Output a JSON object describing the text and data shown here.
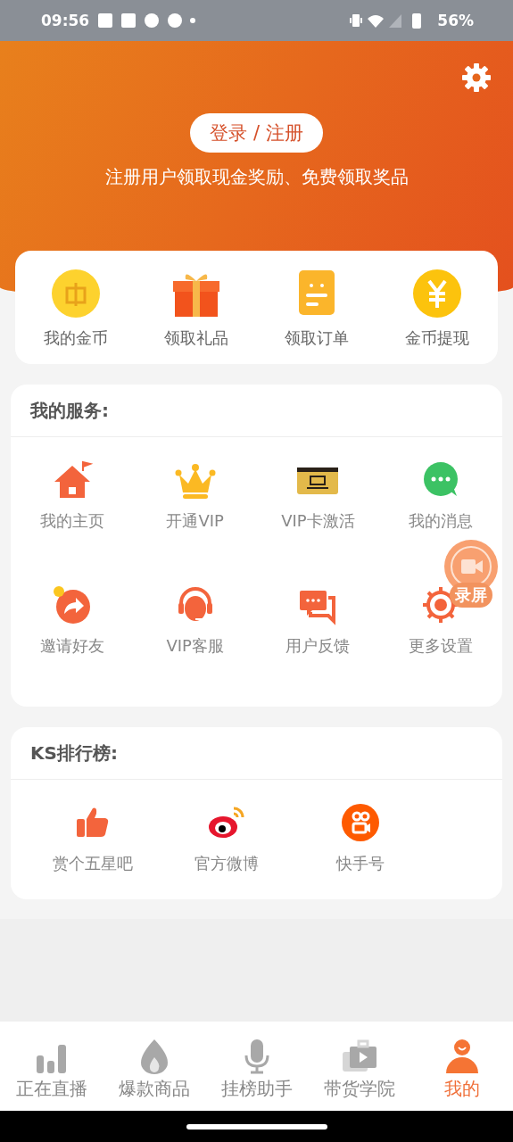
{
  "status_bar": {
    "time": "09:56",
    "battery": "56%"
  },
  "header": {
    "login_button": "登录 / 注册",
    "subtitle": "注册用户领取现金奖励、免费领取奖品"
  },
  "quick_actions": [
    {
      "kind": "coin",
      "label": "我的金币"
    },
    {
      "kind": "gift",
      "label": "领取礼品"
    },
    {
      "kind": "order",
      "label": "领取订单"
    },
    {
      "kind": "yuan",
      "label": "金币提现"
    }
  ],
  "services": {
    "title": "我的服务:",
    "items": [
      {
        "kind": "home",
        "label": "我的主页"
      },
      {
        "kind": "crown",
        "label": "开通VIP"
      },
      {
        "kind": "card",
        "label": "VIP卡激活"
      },
      {
        "kind": "message",
        "label": "我的消息"
      },
      {
        "kind": "share",
        "label": "邀请好友"
      },
      {
        "kind": "headset",
        "label": "VIP客服"
      },
      {
        "kind": "feedback",
        "label": "用户反馈"
      },
      {
        "kind": "gear",
        "label": "更多设置"
      }
    ]
  },
  "ranking": {
    "title": "KS排行榜:",
    "items": [
      {
        "kind": "thumb",
        "label": "赏个五星吧"
      },
      {
        "kind": "weibo",
        "label": "官方微博"
      },
      {
        "kind": "camera",
        "label": "快手号"
      }
    ]
  },
  "floating_record": {
    "label": "录屏"
  },
  "tabs": [
    {
      "kind": "bars",
      "label": "正在直播",
      "selected": false
    },
    {
      "kind": "flame",
      "label": "爆款商品",
      "selected": false
    },
    {
      "kind": "mic",
      "label": "挂榜助手",
      "selected": false
    },
    {
      "kind": "video",
      "label": "带货学院",
      "selected": false
    },
    {
      "kind": "person",
      "label": "我的",
      "selected": true
    }
  ]
}
